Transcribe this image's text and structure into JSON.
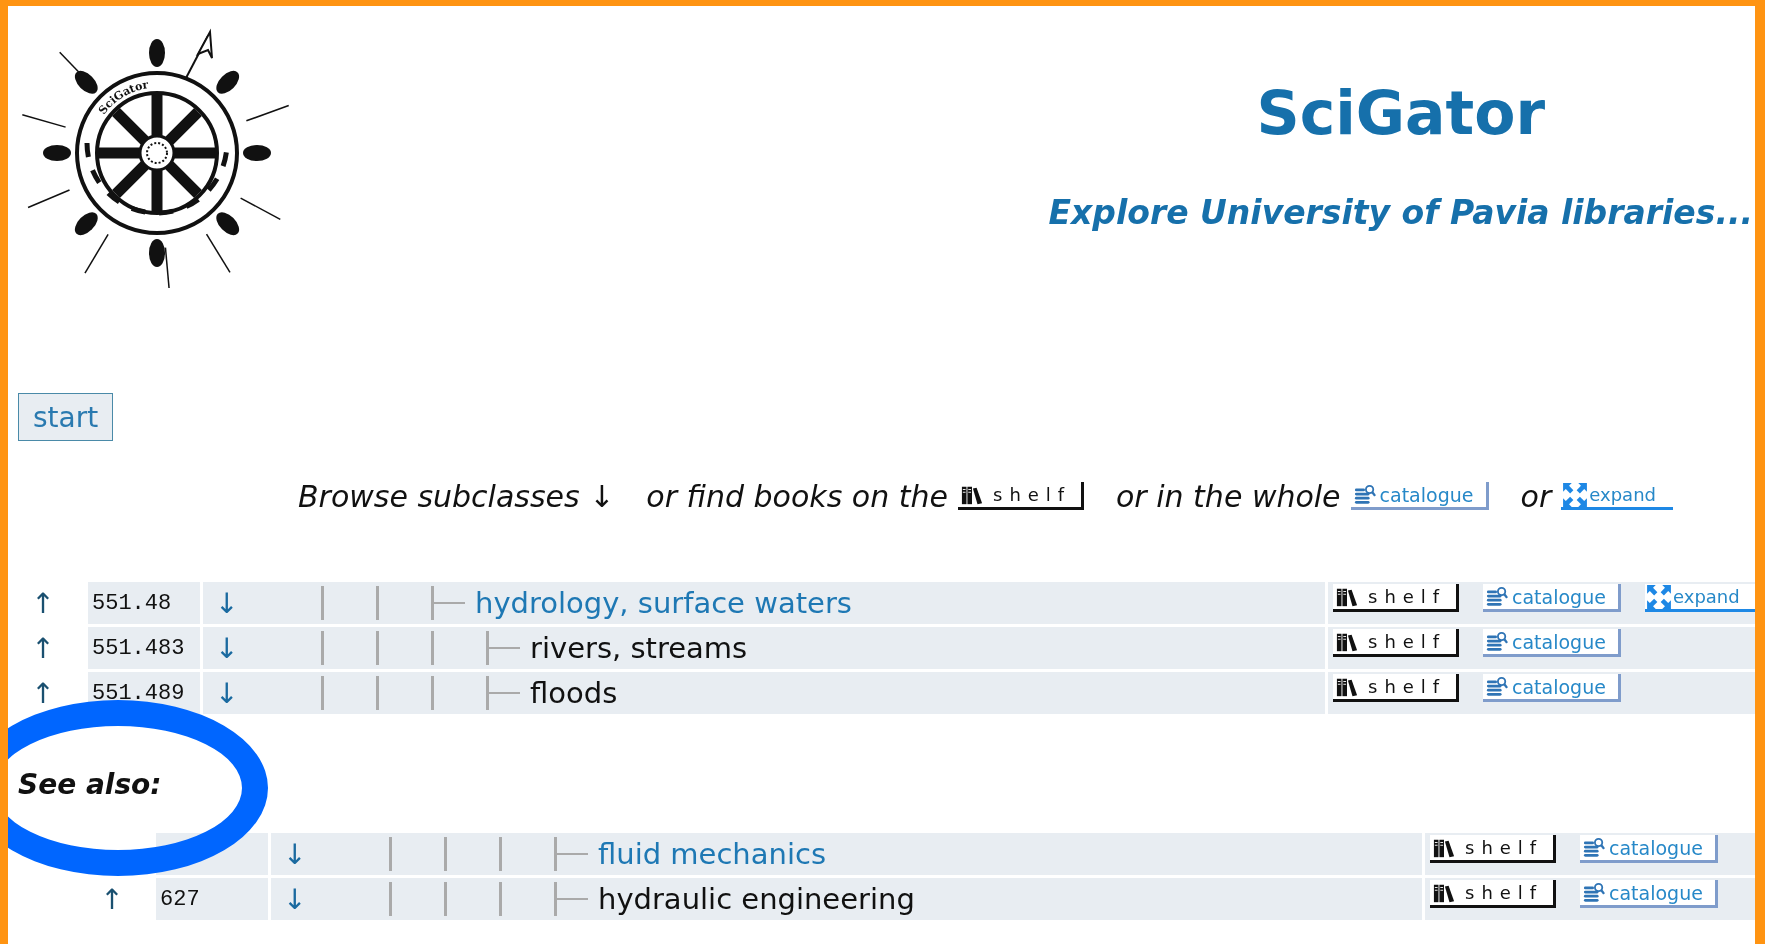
{
  "header": {
    "logo_text": "SciGator",
    "title": "SciGator",
    "subtitle": "Explore University of Pavia libraries..."
  },
  "start_button": "start",
  "instructions": [
    {
      "kind": "text",
      "text": "Browse subclasses ↓"
    },
    {
      "kind": "text",
      "text": "or find books on the"
    },
    {
      "kind": "shelf",
      "label": "shelf"
    },
    {
      "kind": "text",
      "text": "or in the whole"
    },
    {
      "kind": "catalogue",
      "label": "catalogue"
    },
    {
      "kind": "text",
      "text": "or"
    },
    {
      "kind": "expand",
      "label": "expand"
    }
  ],
  "classes": [
    {
      "up": "↑",
      "code": "551.48",
      "down": "↓",
      "label": "hydrology, surface waters",
      "linked": true,
      "actions": [
        {
          "kind": "shelf",
          "label": "shelf"
        },
        {
          "kind": "catalogue",
          "label": "catalogue"
        },
        {
          "kind": "expand",
          "label": "expand"
        }
      ],
      "children": [
        {
          "up": "↑",
          "code": "551.483",
          "down": "↓",
          "label": "rivers, streams",
          "linked": false,
          "actions": [
            {
              "kind": "shelf",
              "label": "shelf"
            },
            {
              "kind": "catalogue",
              "label": "catalogue"
            }
          ]
        },
        {
          "up": "↑",
          "code": "551.489",
          "down": "↓",
          "label": "floods",
          "linked": false,
          "actions": [
            {
              "kind": "shelf",
              "label": "shelf"
            },
            {
              "kind": "catalogue",
              "label": "catalogue"
            }
          ]
        }
      ]
    }
  ],
  "see_also": {
    "heading": "See also:",
    "rows": [
      {
        "down": "↓",
        "label": "fluid mechanics",
        "linked": true,
        "actions": [
          {
            "kind": "shelf",
            "label": "shelf"
          },
          {
            "kind": "catalogue",
            "label": "catalogue"
          }
        ]
      },
      {
        "up": "↑",
        "code": "627",
        "down": "↓",
        "label": "hydraulic engineering",
        "linked": false,
        "actions": [
          {
            "kind": "shelf",
            "label": "shelf"
          },
          {
            "kind": "catalogue",
            "label": "catalogue"
          }
        ]
      }
    ]
  }
}
